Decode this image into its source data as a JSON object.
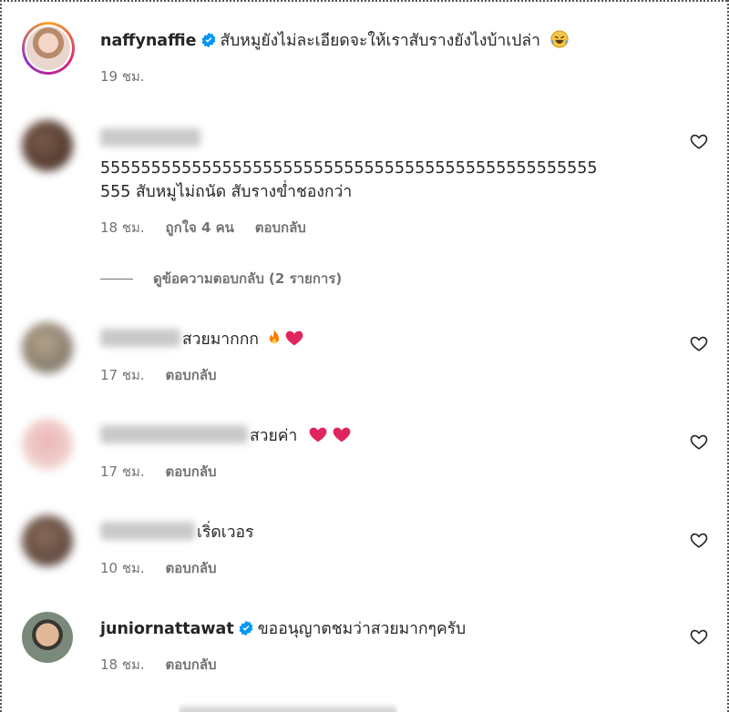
{
  "comments": [
    {
      "username": "naffynaffie",
      "verified": true,
      "text": "สับหมูยังไม่ละเอียดจะให้เราสับรางยังไงบ้าเปล่า",
      "time": "19 ชม.",
      "emoji": "rofl-emoji"
    },
    {
      "username_blurred": true,
      "text": "5555555555555555555555555555555555555555555555555",
      "text2": "555 สับหมูไม่ถนัด สับรางข่ำชองกว่า",
      "time": "18 ชม.",
      "likes": "ถูกใจ 4 คน",
      "reply": "ตอบกลับ"
    },
    {
      "username_blurred": true,
      "text": "สวยมากกก",
      "time": "17 ชม.",
      "reply": "ตอบกลับ"
    },
    {
      "username_blurred": true,
      "text": "สวยค่า",
      "time": "17 ชม.",
      "reply": "ตอบกลับ"
    },
    {
      "username_blurred": true,
      "text": "เริ่ดเวอร",
      "time": "10 ชม.",
      "reply": "ตอบกลับ"
    },
    {
      "username": "juniornattawat",
      "verified": true,
      "text": "ขออนุญาตชมว่าสวยมากๆครับ",
      "time": "18 ชม.",
      "reply": "ตอบกลับ"
    }
  ],
  "view_replies": "ดูข้อความตอบกลับ (2 รายการ)",
  "colors": {
    "verified": "#0095f6",
    "heart_emoji": "#e0245e",
    "story_ring_start": "#f9a825",
    "story_ring_end": "#d62976"
  }
}
